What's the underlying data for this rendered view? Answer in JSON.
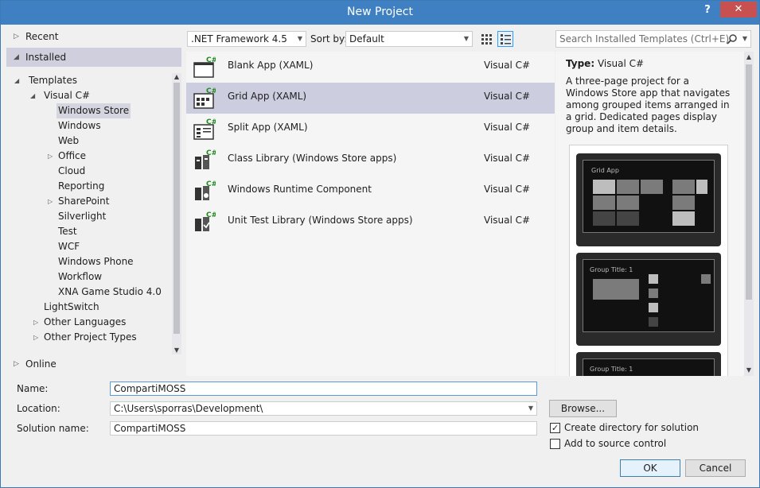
{
  "window": {
    "title": "New Project",
    "help_glyph": "?",
    "close_glyph": "✕"
  },
  "sections": {
    "recent": "Recent",
    "installed": "Installed",
    "online": "Online"
  },
  "tree": {
    "templates": "Templates",
    "visual_csharp": "Visual C#",
    "items": [
      "Windows Store",
      "Windows",
      "Web",
      "Office",
      "Cloud",
      "Reporting",
      "SharePoint",
      "Silverlight",
      "Test",
      "WCF",
      "Windows Phone",
      "Workflow",
      "XNA Game Studio 4.0"
    ],
    "lightswitch": "LightSwitch",
    "other_languages": "Other Languages",
    "other_project_types": "Other Project Types",
    "selected": "Windows Store"
  },
  "toolbar": {
    "framework": ".NET Framework 4.5",
    "sort_by_label": "Sort by:",
    "sort_value": "Default",
    "search_placeholder": "Search Installed Templates (Ctrl+E)"
  },
  "templates": [
    {
      "name": "Blank App (XAML)",
      "lang": "Visual C#",
      "icon": "blank-app-icon"
    },
    {
      "name": "Grid App (XAML)",
      "lang": "Visual C#",
      "icon": "grid-app-icon",
      "selected": true
    },
    {
      "name": "Split App (XAML)",
      "lang": "Visual C#",
      "icon": "split-app-icon"
    },
    {
      "name": "Class Library (Windows Store apps)",
      "lang": "Visual C#",
      "icon": "class-library-icon"
    },
    {
      "name": "Windows Runtime Component",
      "lang": "Visual C#",
      "icon": "runtime-component-icon"
    },
    {
      "name": "Unit Test Library (Windows Store apps)",
      "lang": "Visual C#",
      "icon": "unit-test-icon"
    }
  ],
  "details": {
    "type_label": "Type:",
    "type_value": "Visual C#",
    "description": "A three-page project for a Windows Store app that navigates among grouped items arranged in a grid. Dedicated pages display group and item details.",
    "preview1_title": "Grid App",
    "preview2_title": "Group Title: 1",
    "preview3_title": "Group Title: 1"
  },
  "form": {
    "name_label": "Name:",
    "name_value": "CompartiMOSS",
    "location_label": "Location:",
    "location_value": "C:\\Users\\sporras\\Development\\",
    "solution_label": "Solution name:",
    "solution_value": "CompartiMOSS",
    "browse_label": "Browse...",
    "create_dir_label": "Create directory for solution",
    "create_dir_checked": true,
    "source_control_label": "Add to source control",
    "source_control_checked": false,
    "ok_label": "OK",
    "cancel_label": "Cancel"
  }
}
